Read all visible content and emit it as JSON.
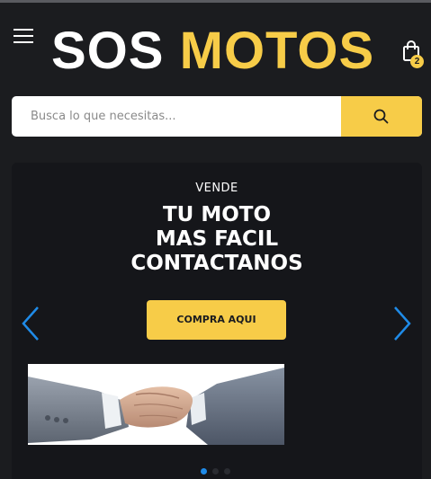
{
  "header": {
    "logo_word1": "SOS",
    "logo_word2": "MOTOS",
    "cart_count": "2"
  },
  "search": {
    "placeholder": "Busca lo que necesitas...",
    "value": ""
  },
  "hero": {
    "kicker": "VENDE",
    "headline_lines": [
      "TU MOTO",
      "MAS FACIL",
      "CONTACTANOS"
    ],
    "cta_label": "COMPRA AQUI",
    "slide_count": 3,
    "active_slide": 1
  },
  "colors": {
    "accent": "#f7cc48",
    "background": "#1b1c1f",
    "slider_bg": "#15161a",
    "arrow": "#1f8be8",
    "dot_active": "#1f8be8"
  },
  "icons": {
    "menu": "hamburger-icon",
    "cart": "shopping-bag-icon",
    "search": "search-icon",
    "prev": "chevron-left-icon",
    "next": "chevron-right-icon"
  }
}
